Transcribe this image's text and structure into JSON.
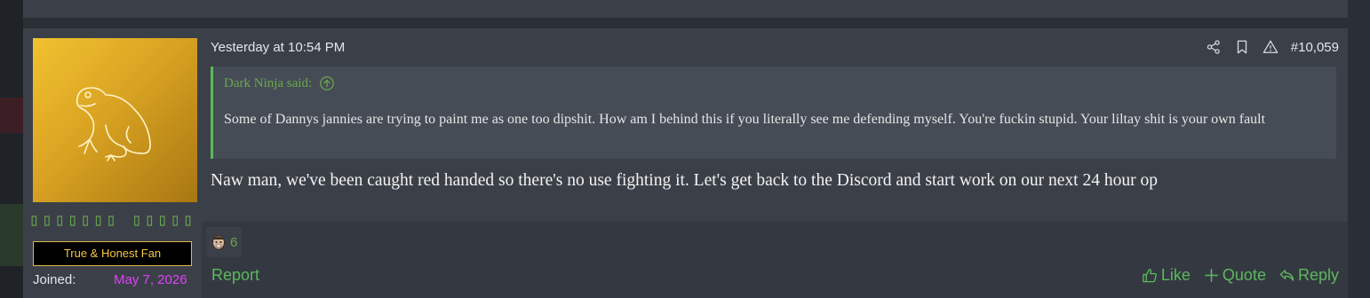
{
  "post": {
    "timestamp": "Yesterday at 10:54 PM",
    "post_number": "#10,059",
    "tools": {
      "share_icon": "share-icon",
      "bookmark_icon": "bookmark-icon",
      "report_icon": "warning-icon"
    },
    "quote": {
      "author": "Dark Ninja said:",
      "jump_icon": "arrow-up-circle-icon",
      "text": "Some of Dannys jannies are trying to paint me as one too dipshit. How am I behind this if you literally see me defending myself. You're fuckin stupid. Your liltay shit is your own fault"
    },
    "message": "Naw man, we've been caught red handed so there's no use fighting it. Let's get back to the Discord and start work on our next 24 hour op",
    "reaction": {
      "icon": "reaction-face-icon",
      "count": "6"
    },
    "report_label": "Report",
    "actions": {
      "like": "Like",
      "quote": "Quote",
      "reply": "Reply"
    }
  },
  "user": {
    "avatar_icon": "frog-icon",
    "username": "▯▯▯▯▯▯▯ ▯▯▯▯▯",
    "title": "True & Honest Fan",
    "joined_label": "Joined:",
    "joined_date": "May 7, 2026"
  },
  "colors": {
    "accent_green": "#5cb85c",
    "username_green": "#6aa84f",
    "joined_date_magenta": "#e040fb",
    "title_gold": "#f5c542"
  }
}
